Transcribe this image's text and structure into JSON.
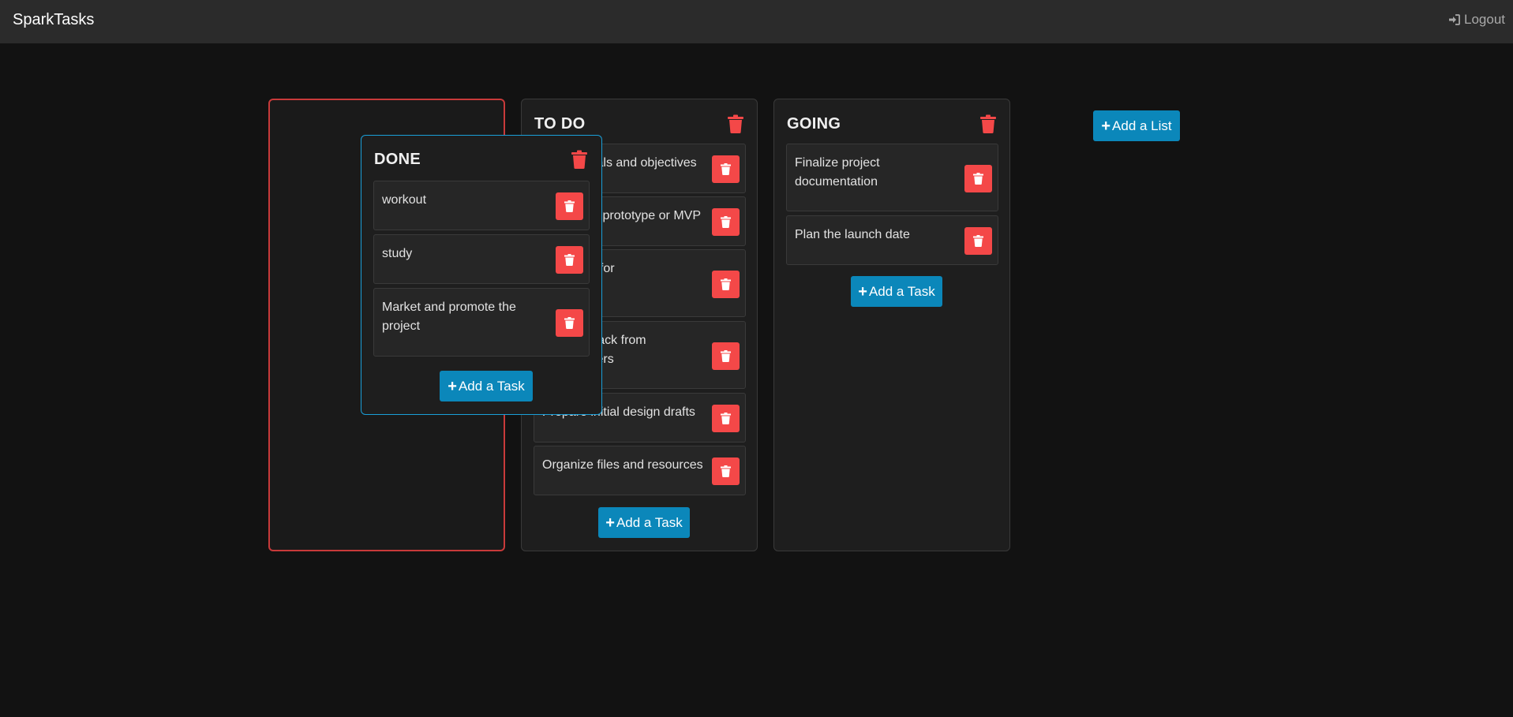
{
  "app": {
    "brand": "SparkTasks",
    "logout_label": "Logout"
  },
  "colors": {
    "background": "#121212",
    "navbar": "#2b2b2b",
    "list_bg": "#1e1e1e",
    "card_bg": "#262626",
    "danger": "#f44848",
    "primary": "#0b87ba",
    "drag_border": "#1a9fd8",
    "drop_placeholder_border": "#c83a3a"
  },
  "lists": {
    "done": {
      "title": "DONE",
      "cards": [
        "workout",
        "study",
        "Market and promote the project"
      ],
      "add_label": "Add a Task"
    },
    "todo": {
      "title": "TO DO",
      "cards": [
        "Define goals and objectives",
        "Develop a prototype or MVP",
        "Prototype for usability",
        "Get feedback from stakeholders",
        "Prepare initial design drafts",
        "Organize files and resources"
      ],
      "add_label": "Add a Task"
    },
    "going": {
      "title": "GOING",
      "cards": [
        "Finalize project documentation",
        "Plan the launch date"
      ],
      "add_label": "Add a Task"
    }
  },
  "board": {
    "add_list_label": "Add a List"
  },
  "icons": {
    "logout": "sign-in-icon",
    "delete": "trash-icon",
    "add": "plus-icon"
  }
}
